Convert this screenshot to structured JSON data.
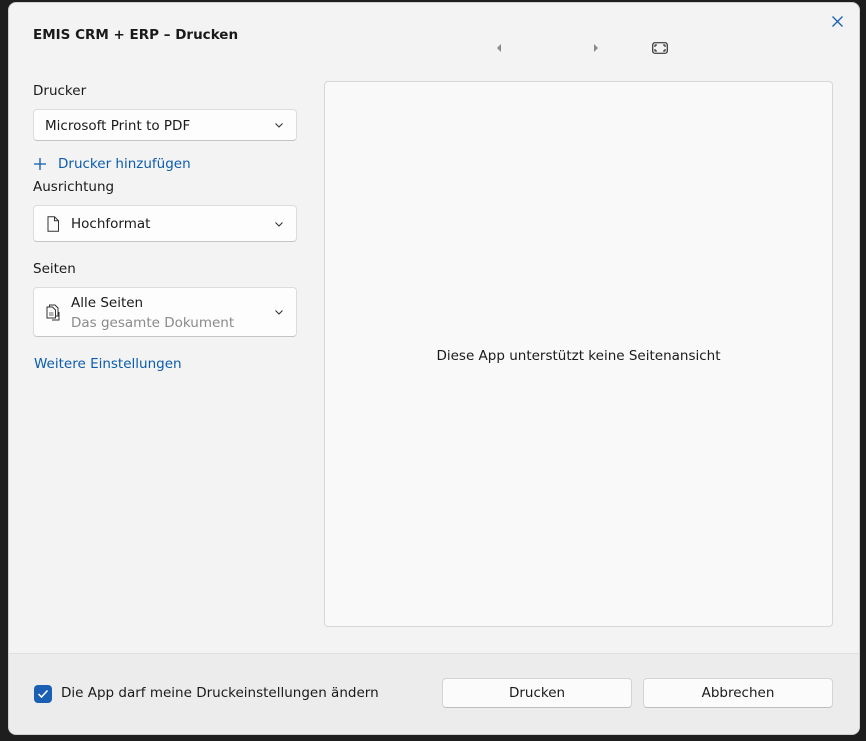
{
  "dialog": {
    "title": "EMIS CRM + ERP – Drucken",
    "close_icon": "close-icon"
  },
  "preview_nav": {
    "prev_icon": "caret-left-icon",
    "next_icon": "caret-right-icon",
    "fit_icon": "fit-to-screen-icon"
  },
  "printer": {
    "label": "Drucker",
    "selected": "Microsoft Print to PDF",
    "add_label": "Drucker hinzufügen"
  },
  "orientation": {
    "label": "Ausrichtung",
    "selected": "Hochformat",
    "icon": "document-icon"
  },
  "pages": {
    "label": "Seiten",
    "selected": "Alle Seiten",
    "subtitle": "Das gesamte Dokument",
    "icon": "pages-icon"
  },
  "more_settings": "Weitere Einstellungen",
  "preview": {
    "message": "Diese App unterstützt keine Seitenansicht"
  },
  "footer": {
    "checkbox_label": "Die App darf meine Druckeinstellungen ändern",
    "checkbox_checked": true,
    "print_button": "Drucken",
    "cancel_button": "Abbrechen"
  },
  "colors": {
    "accent": "#1a5fb4",
    "link": "#0b5cad"
  }
}
